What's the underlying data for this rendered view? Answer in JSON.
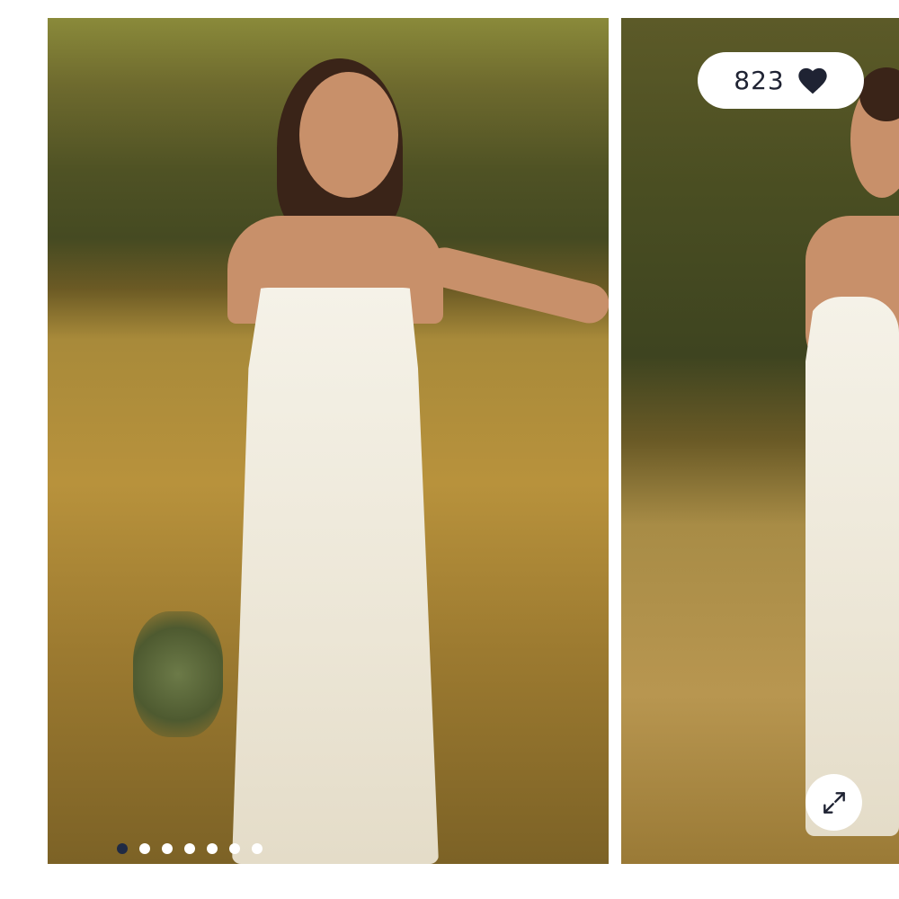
{
  "gallery": {
    "images": [
      {
        "name": "product-image-1"
      },
      {
        "name": "product-image-2"
      }
    ],
    "pagination": {
      "total": 7,
      "active_index": 0
    }
  },
  "likes": {
    "count": "823",
    "icon": "heart-icon"
  },
  "expand": {
    "icon": "expand-icon"
  },
  "colors": {
    "accent": "#1f2a44",
    "pill_text": "#1f2333",
    "background": "#ffffff"
  }
}
